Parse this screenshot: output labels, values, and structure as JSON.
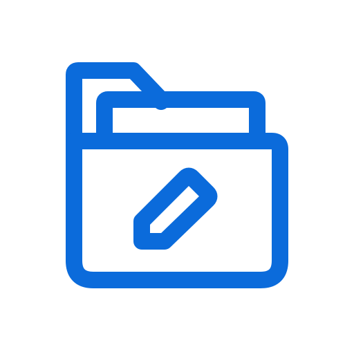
{
  "icon": {
    "name": "edit-folder-icon",
    "stroke_color": "#0B6BDB",
    "background_color": "#FFFFFF"
  }
}
